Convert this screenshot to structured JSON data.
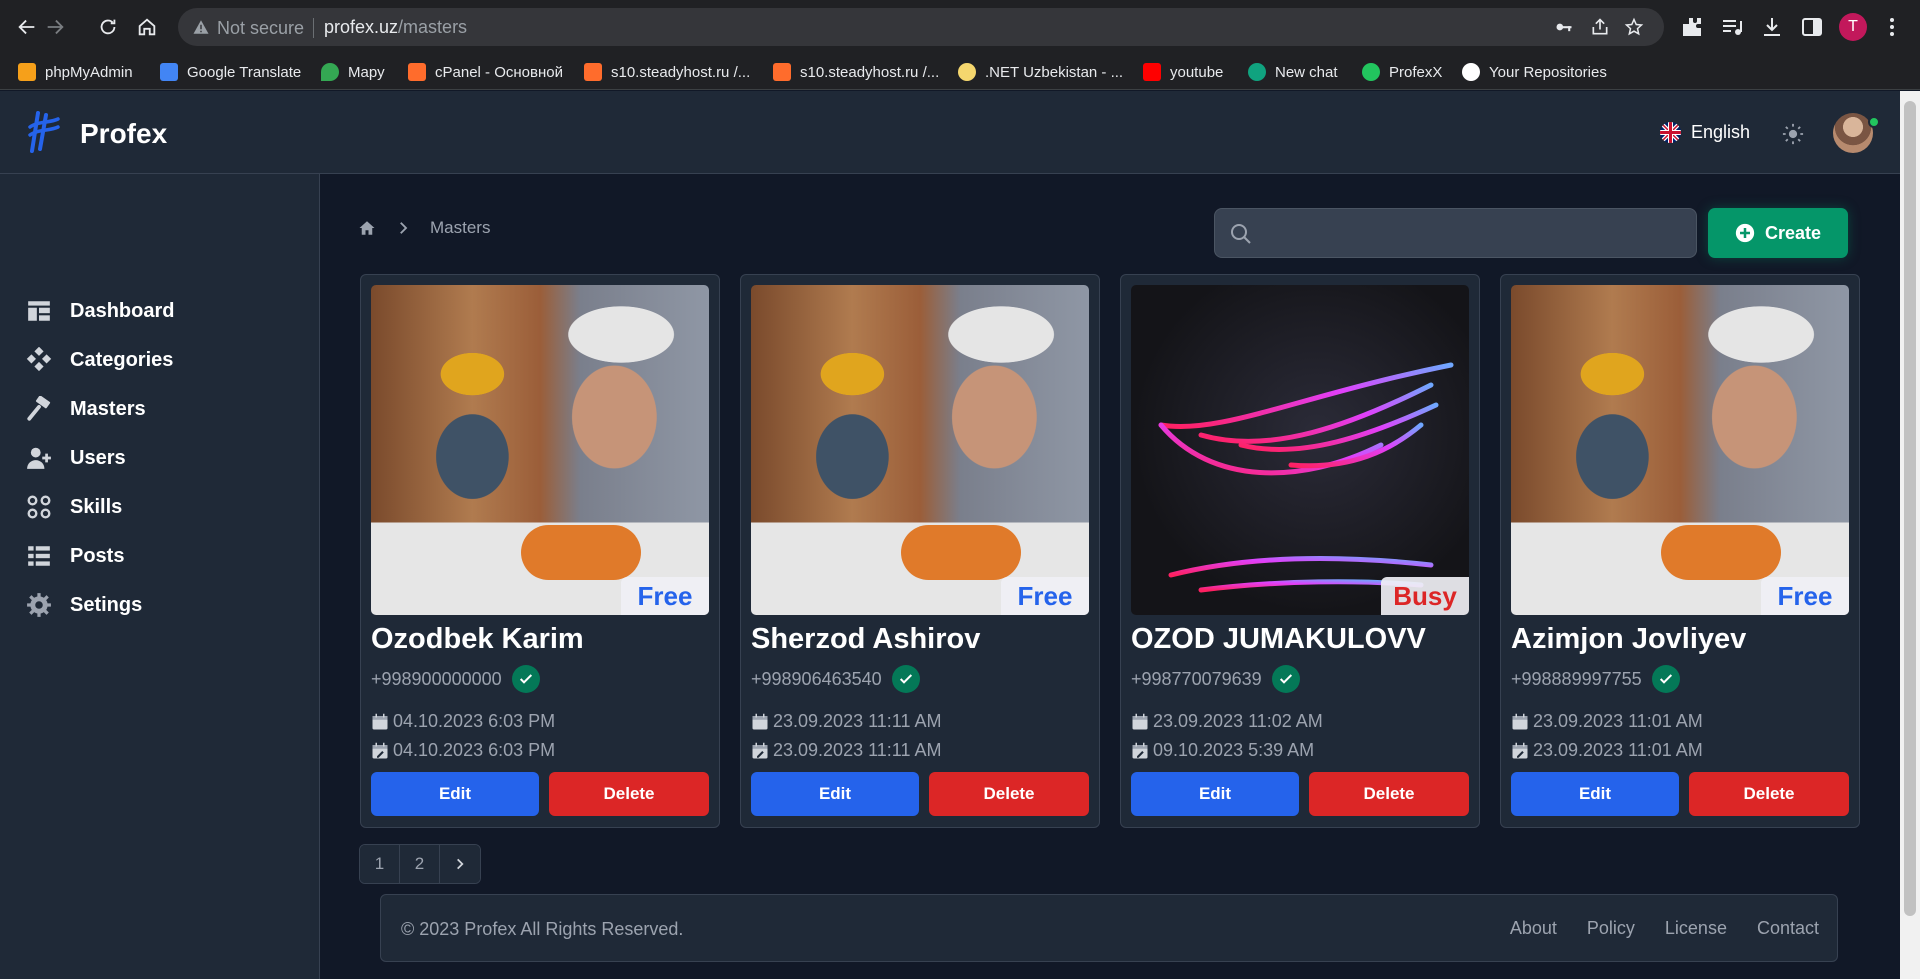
{
  "browser": {
    "not_secure": "Not secure",
    "url_host": "profex.uz",
    "url_path": "/masters",
    "profile_initial": "T"
  },
  "bookmarks": [
    {
      "label": "phpMyAdmin",
      "color": "#f6a01a"
    },
    {
      "label": "Google Translate",
      "color": "#4285f4"
    },
    {
      "label": "Mapy",
      "color": "#34a853"
    },
    {
      "label": "cPanel - Основной",
      "color": "#ff6c2c"
    },
    {
      "label": "s10.steadyhost.ru /...",
      "color": "#ff6c2c"
    },
    {
      "label": "s10.steadyhost.ru /...",
      "color": "#ff6c2c"
    },
    {
      "label": ".NET Uzbekistan - ...",
      "color": "#f5d76e"
    },
    {
      "label": "youtube",
      "color": "#ff0000"
    },
    {
      "label": "New chat",
      "color": "#10a37f"
    },
    {
      "label": "ProfexX",
      "color": "#22c55e"
    },
    {
      "label": "Your Repositories",
      "color": "#ffffff"
    }
  ],
  "app": {
    "brand": "Profex",
    "language": "English"
  },
  "sidebar": {
    "items": [
      {
        "label": "Dashboard",
        "icon": "dashboard-icon"
      },
      {
        "label": "Categories",
        "icon": "categories-icon"
      },
      {
        "label": "Masters",
        "icon": "hammer-icon"
      },
      {
        "label": "Users",
        "icon": "user-add-icon"
      },
      {
        "label": "Skills",
        "icon": "skills-icon"
      },
      {
        "label": "Posts",
        "icon": "list-icon"
      },
      {
        "label": "Setings",
        "icon": "gear-icon"
      }
    ]
  },
  "breadcrumb": {
    "current": "Masters"
  },
  "search": {
    "placeholder": "",
    "value": ""
  },
  "toolbar": {
    "create_label": "Create"
  },
  "masters": [
    {
      "name": "Ozodbek Karim",
      "phone": "+998900000000",
      "status": "Free",
      "created": "04.10.2023 6:03 PM",
      "updated": "04.10.2023 6:03 PM",
      "edit": "Edit",
      "delete": "Delete"
    },
    {
      "name": "Sherzod Ashirov",
      "phone": "+998906463540",
      "status": "Free",
      "created": "23.09.2023 11:11 AM",
      "updated": "23.09.2023 11:11 AM",
      "edit": "Edit",
      "delete": "Delete"
    },
    {
      "name": "OZOD JUMAKULOVV",
      "phone": "+998770079639",
      "status": "Busy",
      "created": "23.09.2023 11:02 AM",
      "updated": "09.10.2023 5:39 AM",
      "edit": "Edit",
      "delete": "Delete"
    },
    {
      "name": "Azimjon Jovliyev",
      "phone": "+998889997755",
      "status": "Free",
      "created": "23.09.2023 11:01 AM",
      "updated": "23.09.2023 11:01 AM",
      "edit": "Edit",
      "delete": "Delete"
    }
  ],
  "pagination": {
    "pages": [
      "1",
      "2"
    ]
  },
  "footer": {
    "copyright": "© 2023 Profex All Rights Reserved.",
    "links": [
      "About",
      "Policy",
      "License",
      "Contact"
    ]
  },
  "colors": {
    "accent_create": "#059669",
    "edit": "#2563eb",
    "delete": "#dc2626",
    "free": "#2563eb",
    "busy": "#dc2626"
  }
}
